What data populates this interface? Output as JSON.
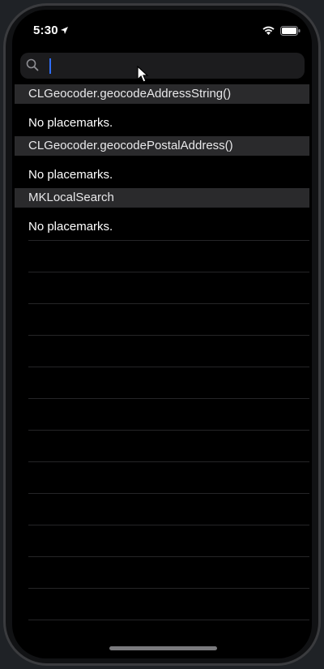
{
  "status_bar": {
    "time": "5:30",
    "icons": [
      "location-icon",
      "wifi-icon",
      "battery-icon"
    ]
  },
  "search": {
    "value": "",
    "placeholder": ""
  },
  "sections": [
    {
      "header": "CLGeocoder.geocodeAddressString()",
      "row": "No placemarks."
    },
    {
      "header": "CLGeocoder.geocodePostalAddress()",
      "row": "No placemarks."
    },
    {
      "header": "MKLocalSearch",
      "row": "No placemarks."
    }
  ],
  "colors": {
    "background": "#000000",
    "section_header": "#2a2a2c",
    "search_field": "#1c1c1e",
    "caret": "#2f6df6",
    "text": "#ffffff"
  }
}
